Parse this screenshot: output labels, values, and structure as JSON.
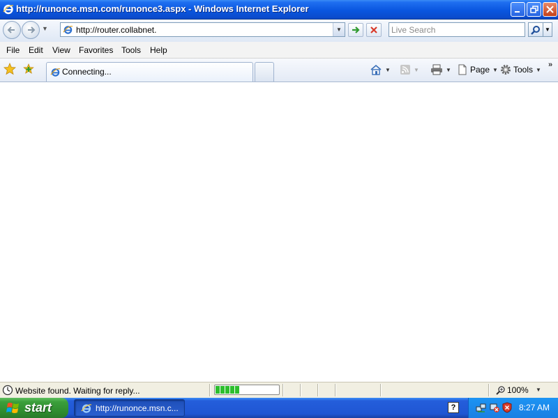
{
  "window": {
    "title": "http://runonce.msn.com/runonce3.aspx - Windows Internet Explorer",
    "titlebar_color": "#0a56e0"
  },
  "address_bar": {
    "url": "http://router.collabnet.",
    "search_placeholder": "Live Search"
  },
  "menu": {
    "items": [
      "File",
      "Edit",
      "View",
      "Favorites",
      "Tools",
      "Help"
    ]
  },
  "tabs": {
    "active_label": "Connecting..."
  },
  "command_bar": {
    "page_label": "Page",
    "tools_label": "Tools"
  },
  "status_bar": {
    "text": "Website found. Waiting for reply...",
    "progress_percent": 38,
    "zoom": "100%"
  },
  "taskbar": {
    "start_label": "start",
    "task_button_label": "http://runonce.msn.c...",
    "help_glyph": "?",
    "clock": "8:27 AM"
  },
  "icons": [
    "ie-logo-icon",
    "back-arrow-icon",
    "forward-arrow-icon",
    "go-arrow-icon",
    "stop-x-icon",
    "search-magnifier-icon",
    "favorites-star-icon",
    "add-favorites-icon",
    "home-icon",
    "feeds-icon",
    "print-icon",
    "page-icon",
    "gear-icon",
    "globe-status-icon",
    "zoom-magnifier-icon",
    "windows-flag-icon",
    "network-icon",
    "security-shield-icon"
  ]
}
